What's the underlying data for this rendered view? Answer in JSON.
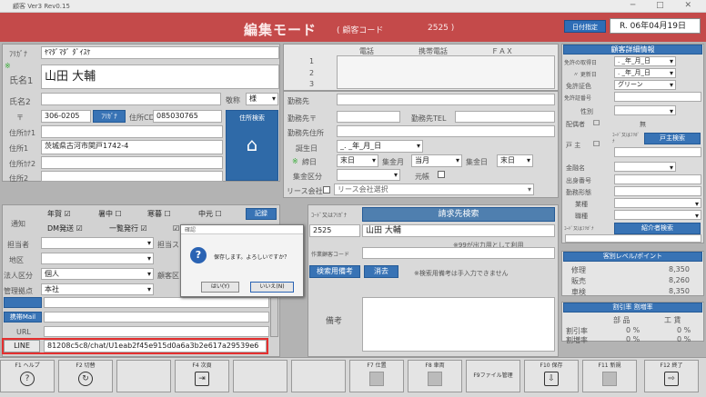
{
  "window": {
    "title": "顧客 Ver3 Rev0.15",
    "controls": "─ □ ✕"
  },
  "header": {
    "mode": "編集モード",
    "code_label": "( 顧客コード",
    "code_value": "2525 )",
    "date_button": "日付指定",
    "date": "R. 06年04月19日"
  },
  "customer": {
    "furigana_label": "ﾌﾘｶﾞﾅ",
    "furigana": "ﾔﾏﾀﾞﾏﾀﾞ ﾀﾞｲｽｹ",
    "name1_label": "氏名1",
    "name1": "山田 大輔",
    "name2_label": "氏名2",
    "honorific_label": "敬称",
    "honorific": "様",
    "zip_label": "〒",
    "zip": "306-0205",
    "furigana_btn": "ﾌﾘｶﾞﾅ",
    "addr_cd_label": "住所CD",
    "addr_cd": "085030765",
    "addr_search": "住所検索",
    "addrkana1_label": "住所ｶﾅ1",
    "addr1_label": "住所1",
    "addr1": "茨城県古河市関戸1742-4",
    "addrkana2_label": "住所ｶﾅ2",
    "addr2_label": "住所2"
  },
  "phones": {
    "col_tel": "電話",
    "col_mobile": "携帯電話",
    "col_fax": "ＦＡＸ",
    "rows": [
      "1",
      "2",
      "3"
    ]
  },
  "work": {
    "workplace": "勤務先",
    "work_zip": "勤務先〒",
    "work_tel": "勤務先TEL",
    "work_addr": "勤務先住所"
  },
  "birthday": {
    "label": "誕生日",
    "value": "_. _年_月_日",
    "close_label": "締日",
    "close": "末日",
    "collect_month_label": "集金月",
    "collect_month": "当月",
    "collect_day_label": "集金日",
    "collect_day": "末日",
    "area_label": "集金区分",
    "ledger_label": "元帳",
    "lease_label": "リース会社",
    "lease_choice": "リース会社選択"
  },
  "notify": {
    "label": "通知",
    "nenga": "年賀",
    "shochu": "暑中",
    "kanbo": "寒暮",
    "chugen": "中元",
    "dm": "DM発送",
    "ichiran": "一覧発行",
    "te": "テ",
    "record": "記録"
  },
  "form": {
    "staff": "担当者",
    "region": "地区",
    "corp_label": "法人区分",
    "corp": "個人",
    "mgmt_label": "管理拠点",
    "mgmt": "本社",
    "staff2": "担当ス",
    "client_cat": "顧客区",
    "mail_label": "携帯Mail",
    "url_label": "URL",
    "line_label": "LINE",
    "line_value": "81208c5c8/chat/U1eab2f45e915d0a6a3b2e617a29539e6"
  },
  "billing": {
    "code_label": "ｺｰﾄﾞ又はﾌﾘｶﾞﾅ",
    "header": "請求先検索",
    "code": "2525",
    "name": "山田 大輔",
    "note": "※99が出力用として利用",
    "ops_label": "作業顧客コード",
    "memo_btn": "検索用備考",
    "memo_val": "消去",
    "memo_note": "※検索用備考は手入力できません",
    "remarks": "備考"
  },
  "modal": {
    "title": "確認",
    "message": "保存します。よろしいですか？",
    "yes": "はい(Y)",
    "no": "いいえ(N)"
  },
  "right": {
    "head": "顧客詳細情報",
    "license_date": "免許の取得日",
    "renew_date": "〃 更新日",
    "license_color": "免許証色",
    "license_color_val": "グリーン",
    "license_no": "免許証番号",
    "gender": "性別",
    "spouse": "配偶者",
    "spouse_val": "無",
    "householder": "戸 主",
    "code_kana": "ｺｰﾄﾞ又はﾌﾘｶﾞﾅ",
    "householder_btn": "戸主検索",
    "school": "金融名",
    "branch": "出身番号",
    "job": "勤務形態",
    "work": "業種",
    "post": "職種",
    "introducer": "ｺｰﾄﾞ又はﾌﾘｶﾞﾅ",
    "intro_btn": "紹介者検索",
    "rank_head": "客別レベル/ポイント",
    "rank_rows": [
      {
        "k": "修理",
        "v": "8,350"
      },
      {
        "k": "販売",
        "v": "8,260"
      },
      {
        "k": "車検",
        "v": "8,350"
      }
    ],
    "disc_head": "割引率 割増率",
    "disc_cols": [
      "部 品",
      "工 賃"
    ],
    "disc_rows": [
      {
        "k": "割引率",
        "a": "0 %",
        "b": "0 %"
      },
      {
        "k": "割増率",
        "a": "0 %",
        "b": "0 %"
      }
    ]
  },
  "fkeys": [
    {
      "k": "F1 ヘルプ",
      "i": "?"
    },
    {
      "k": "F2 切替",
      "i": "↻"
    },
    {
      "k": "",
      "i": ""
    },
    {
      "k": "F4 次頁",
      "i": "⇥"
    },
    {
      "k": "",
      "i": ""
    },
    {
      "k": "",
      "i": ""
    },
    {
      "k": "F7 仕置",
      "i": ""
    },
    {
      "k": "F8 車両",
      "i": ""
    },
    {
      "k": "F9ファイル管理",
      "i": ""
    },
    {
      "k": "F10 保存",
      "i": "⇩"
    },
    {
      "k": "F11 新規",
      "i": ""
    },
    {
      "k": "F12 終了",
      "i": "⇨"
    }
  ]
}
